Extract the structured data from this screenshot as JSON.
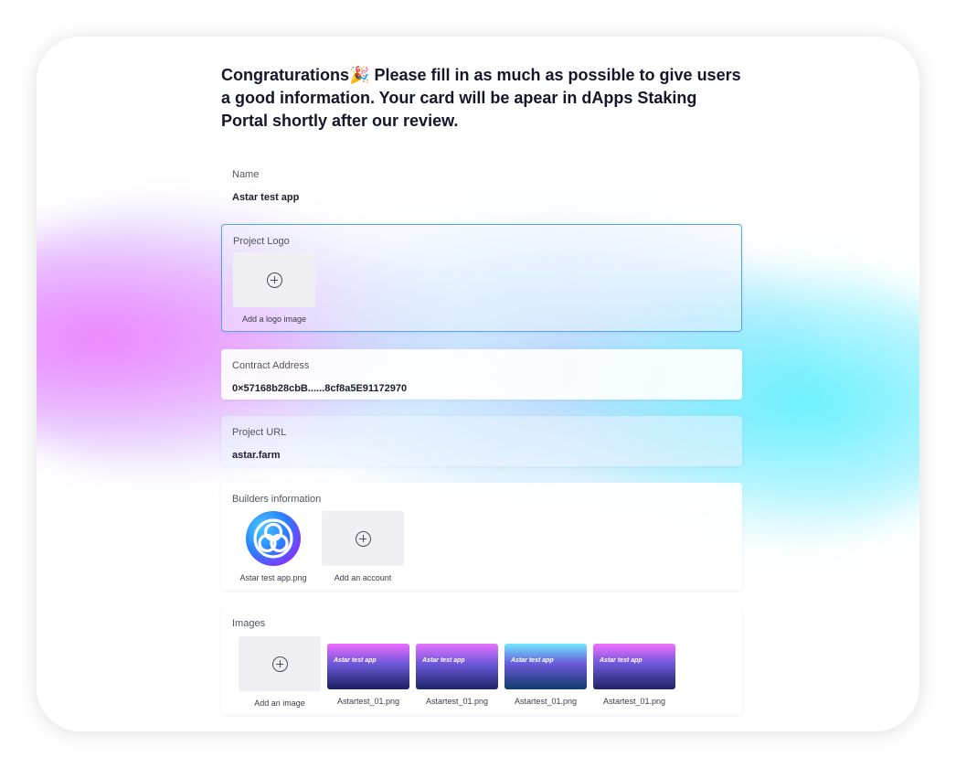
{
  "headline": {
    "text": "Congraturations",
    "emoji": "🎉",
    "rest": " Please fill in as much as possible to give users a good information. Your card will be apear in dApps Staking Portal shortly after our review."
  },
  "name": {
    "label": "Name",
    "value": "Astar test app"
  },
  "project_logo": {
    "label": "Project Logo",
    "add_caption": "Add a logo image"
  },
  "contract_address": {
    "label": "Contract Address",
    "value": "0×57168b28cbB......8cf8a5E91172970"
  },
  "project_url": {
    "label": "Project URL",
    "value": "astar.farm"
  },
  "builders": {
    "label": "Builders information",
    "items": [
      {
        "caption": "Astar test app.png",
        "icon": "astar-logo-icon"
      }
    ],
    "add_caption": "Add an account"
  },
  "images": {
    "label": "Images",
    "add_caption": "Add an image",
    "items": [
      {
        "caption": "Astartest_01.png",
        "thumb_text": "Astar test app",
        "top_color": "#f06bff",
        "bottom_color": "#1b1f5e"
      },
      {
        "caption": "Astartest_01.png",
        "thumb_text": "Astar test app",
        "top_color": "#e673ff",
        "bottom_color": "#1d2668"
      },
      {
        "caption": "Astartest_01.png",
        "thumb_text": "Astar test app",
        "top_color": "#6fe8ff",
        "bottom_color": "#103c6a"
      },
      {
        "caption": "Astartest_01.png",
        "thumb_text": "Astar test app",
        "top_color": "#f370ff",
        "bottom_color": "#1f2362"
      }
    ]
  },
  "colors": {
    "accent_border": "#55a4ee",
    "text_primary": "#15162b",
    "add_box_bg": "#efeff4"
  }
}
